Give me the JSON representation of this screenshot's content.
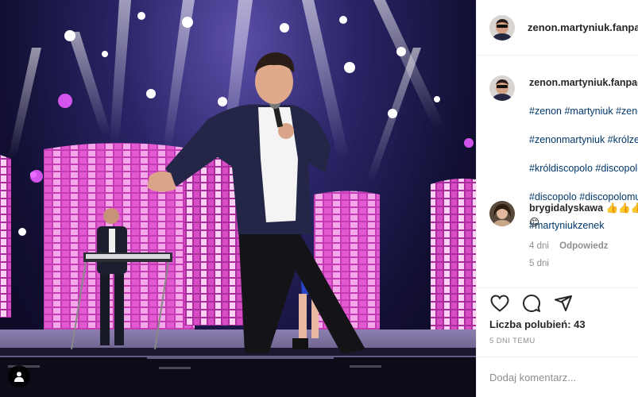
{
  "post": {
    "author": "zenon.martyniuk.fanpage",
    "media_alt": "",
    "likes_text": "Liczba polubień: 43",
    "date": "5 DNI TEMU"
  },
  "caption": {
    "username": "zenon.martyniuk.fanpage",
    "hashtag_lines": [
      "#zenon #martyniuk #zenek",
      "#zenonmartyniuk #królzenon",
      "#króldiscopolo #discopolopl",
      "#discopolo #discopolomusic",
      "#martyniukzenek"
    ],
    "time": "5 dni"
  },
  "comments": [
    {
      "username": "brygidalyskawa",
      "text": "👍👍👍",
      "line2": "😊",
      "time": "4 dni",
      "reply_label": "Odpowiedz"
    }
  ],
  "composer": {
    "placeholder": "Dodaj komentarz..."
  },
  "icons": {
    "like": "heart-icon",
    "comment": "comment-icon",
    "share": "share-icon",
    "user_tag": "user-tag-icon"
  },
  "colors": {
    "hashtag": "#00376b",
    "muted": "#8e8e8e",
    "stage_pink": "#e44fd0"
  }
}
